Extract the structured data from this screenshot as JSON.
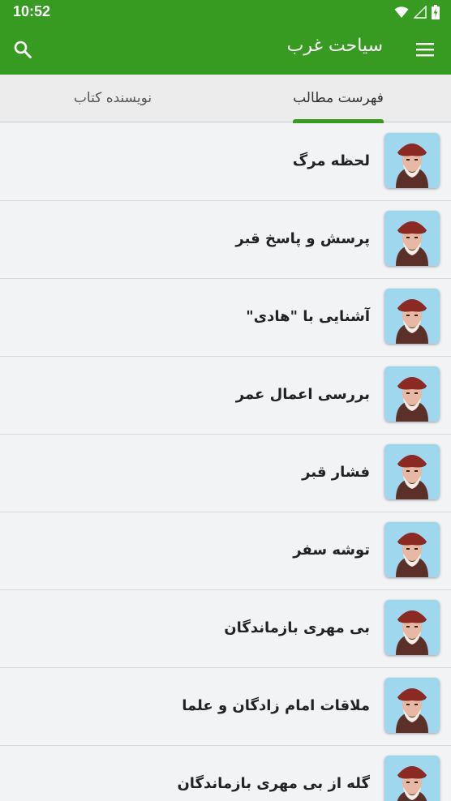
{
  "status_bar": {
    "time": "10:52",
    "icons": [
      "wifi-icon",
      "cellular-signal-icon",
      "battery-icon"
    ]
  },
  "app_bar": {
    "title": "سیاحت غرب",
    "menu_icon": "hamburger-menu-icon",
    "search_icon": "search-icon"
  },
  "tabs": [
    {
      "label": "فهرست مطالب",
      "selected": true
    },
    {
      "label": "نویسنده کتاب",
      "selected": false
    }
  ],
  "items": [
    {
      "title": "لحظه مرگ"
    },
    {
      "title": "پرسش و پاسخ قبر"
    },
    {
      "title": "آشنایی با \"هادی\""
    },
    {
      "title": "بررسی اعمال عمر"
    },
    {
      "title": "فشار قبر"
    },
    {
      "title": "توشه سفر"
    },
    {
      "title": "بی مهری بازماندگان"
    },
    {
      "title": "ملاقات امام زادگان و علما"
    },
    {
      "title": "گله از بی مهری بازماندگان"
    }
  ],
  "colors": {
    "primary": "#379b22",
    "tab_background": "#ececec",
    "list_background": "#f2f3f5",
    "text": "#222222"
  }
}
